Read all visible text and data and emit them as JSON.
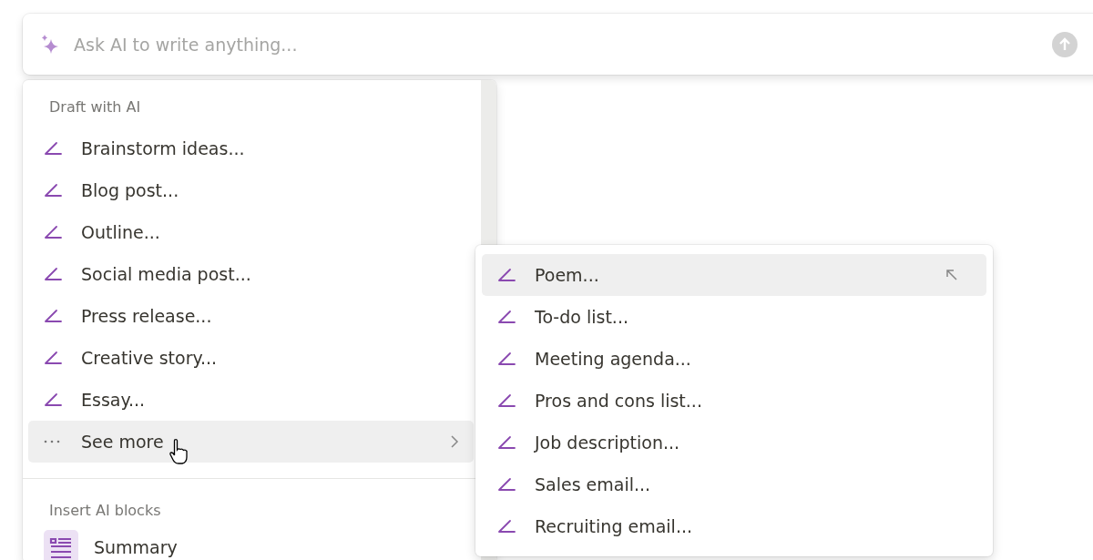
{
  "ai_input": {
    "placeholder": "Ask AI to write anything..."
  },
  "draft_menu": {
    "heading": "Draft with AI",
    "items": [
      {
        "label": "Brainstorm ideas...",
        "kind": "pen",
        "selected": false
      },
      {
        "label": "Blog post...",
        "kind": "pen",
        "selected": false
      },
      {
        "label": "Outline...",
        "kind": "pen",
        "selected": false
      },
      {
        "label": "Social media post...",
        "kind": "pen",
        "selected": false
      },
      {
        "label": "Press release...",
        "kind": "pen",
        "selected": false
      },
      {
        "label": "Creative story...",
        "kind": "pen",
        "selected": false
      },
      {
        "label": "Essay...",
        "kind": "pen",
        "selected": false
      },
      {
        "label": "See more",
        "kind": "more",
        "selected": true
      }
    ]
  },
  "blocks_section": {
    "heading": "Insert AI blocks",
    "items": [
      {
        "label": "Summary",
        "kind": "summary",
        "selected": false
      }
    ]
  },
  "submenu": {
    "items": [
      {
        "label": "Poem...",
        "kind": "pen",
        "selected": true
      },
      {
        "label": "To-do list...",
        "kind": "pen",
        "selected": false
      },
      {
        "label": "Meeting agenda...",
        "kind": "pen",
        "selected": false
      },
      {
        "label": "Pros and cons list...",
        "kind": "pen",
        "selected": false
      },
      {
        "label": "Job description...",
        "kind": "pen",
        "selected": false
      },
      {
        "label": "Sales email...",
        "kind": "pen",
        "selected": false
      },
      {
        "label": "Recruiting email...",
        "kind": "pen",
        "selected": false
      }
    ]
  }
}
